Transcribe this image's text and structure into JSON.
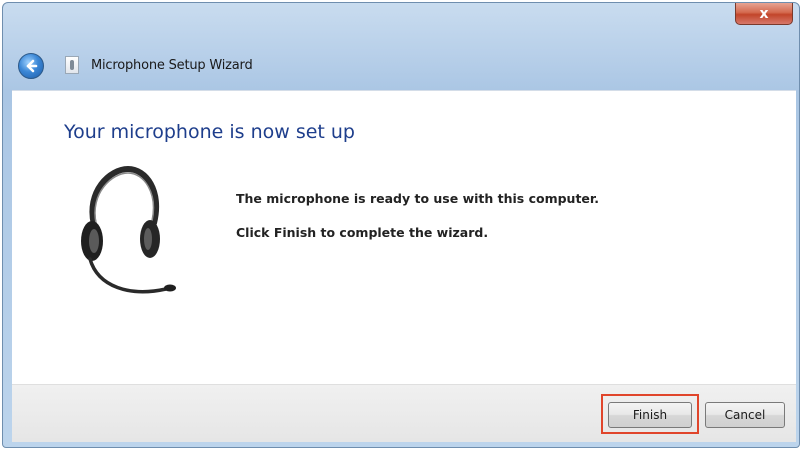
{
  "window": {
    "title": "Microphone Setup Wizard",
    "close_glyph": "x",
    "back_icon": "back-arrow-icon",
    "accent_color": "#e0452b"
  },
  "content": {
    "heading": "Your microphone is now set up",
    "message_ready": "The microphone is ready to use with this computer.",
    "message_finish": "Click Finish to complete the wizard.",
    "illustration_icon": "headset-icon"
  },
  "footer": {
    "finish_label": "Finish",
    "cancel_label": "Cancel"
  }
}
